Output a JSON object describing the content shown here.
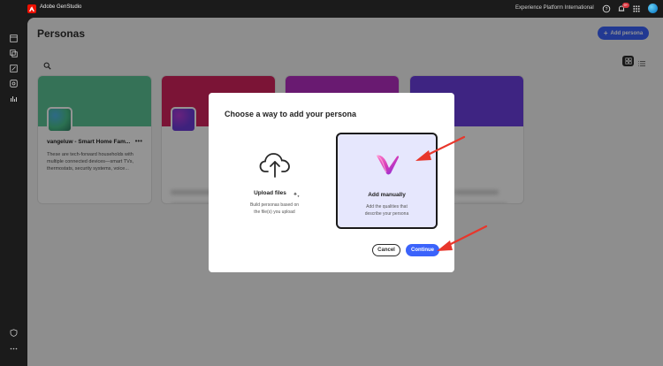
{
  "app": {
    "title": "Adobe GenStudio",
    "org": "Experience Platform International",
    "notification_count": "9+"
  },
  "page": {
    "title": "Personas",
    "add_button": "Add persona"
  },
  "personas": [
    {
      "name": "vangeluw - Smart Home Fam...",
      "description": "These are tech-forward households with multiple connected devices—smart TVs, thermostats, security systems, voice..."
    }
  ],
  "dialog": {
    "title": "Choose a way to add your persona",
    "options": [
      {
        "label": "Upload files",
        "description": "Build personas based on the file(s) you upload"
      },
      {
        "label": "Add manually",
        "description": "Add the qualities that describe your persona"
      }
    ],
    "cancel_label": "Cancel",
    "continue_label": "Continue"
  },
  "colors": {
    "accent": "#3b63fb",
    "annotation_arrow": "#e8362b",
    "selected_option_bg": "#e6e7fd"
  },
  "icons": [
    "adobe-logo-icon",
    "help-icon",
    "bell-icon",
    "apps-grid-icon",
    "search-icon",
    "grid-view-icon",
    "list-view-icon",
    "cloud-upload-icon",
    "sparkle-icon",
    "genstudio-v-icon",
    "plus-icon",
    "more-icon"
  ]
}
